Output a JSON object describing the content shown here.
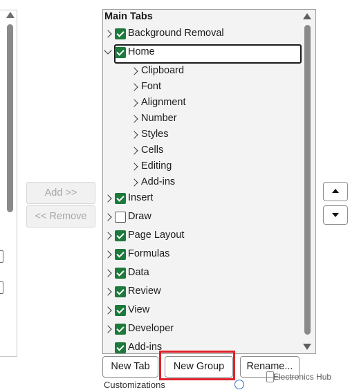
{
  "left_panel": {},
  "transfer": {
    "add_label": "Add >>",
    "remove_label": "<< Remove"
  },
  "tree": {
    "title": "Main Tabs",
    "items": [
      {
        "label": "Background Removal",
        "checked": true
      },
      {
        "label": "Home",
        "checked": true,
        "expanded": true,
        "selected": true
      },
      {
        "label": "Clipboard"
      },
      {
        "label": "Font"
      },
      {
        "label": "Alignment"
      },
      {
        "label": "Number"
      },
      {
        "label": "Styles"
      },
      {
        "label": "Cells"
      },
      {
        "label": "Editing"
      },
      {
        "label": "Add-ins"
      },
      {
        "label": "Insert",
        "checked": true
      },
      {
        "label": "Draw",
        "checked": false
      },
      {
        "label": "Page Layout",
        "checked": true
      },
      {
        "label": "Formulas",
        "checked": true
      },
      {
        "label": "Data",
        "checked": true
      },
      {
        "label": "Review",
        "checked": true
      },
      {
        "label": "View",
        "checked": true
      },
      {
        "label": "Developer",
        "checked": true
      },
      {
        "label": "Add-ins",
        "checked": true
      }
    ]
  },
  "buttons": {
    "new_tab": "New Tab",
    "new_group": "New Group",
    "rename": "Rename..."
  },
  "partial_label": "Customizations",
  "watermark": "Electronics Hub",
  "colors": {
    "checkbox": "#1d7a3c",
    "highlight": "#e0202a"
  }
}
